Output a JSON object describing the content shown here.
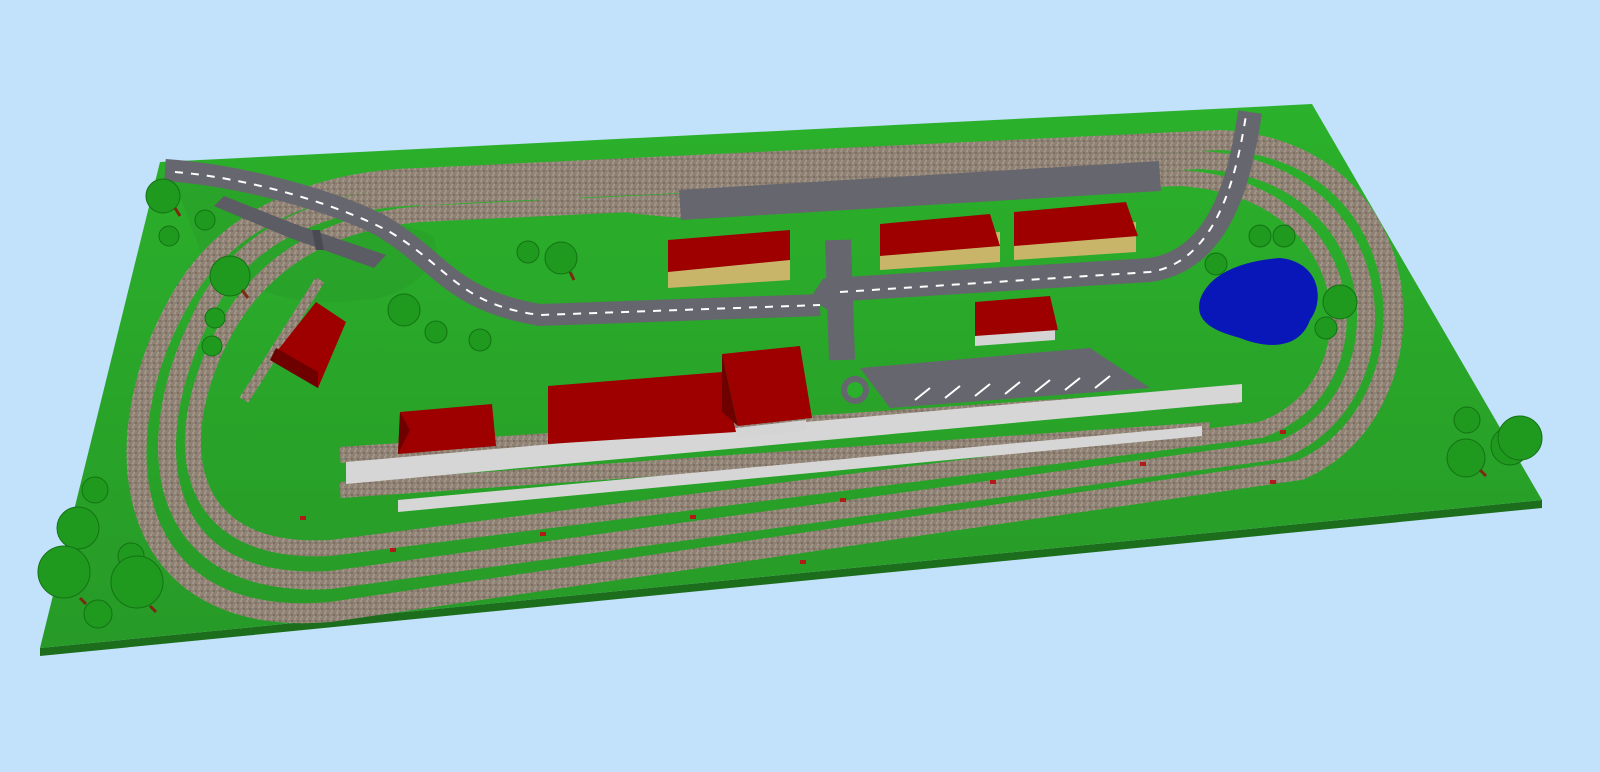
{
  "scene": {
    "sky_color": "#c2e1fb",
    "baseboard_color": "#2aa52a",
    "baseboard_edge_color": "#1c6e1c",
    "track_color": "#8a7b6c",
    "sleeper_color": "#6b4c3a",
    "rail_color": "#c9c3bb",
    "road_color": "#66666e",
    "road_marking_color": "#ffffff",
    "platform_color": "#d6d6d6",
    "roof_color": "#9e0000",
    "roof_dark_color": "#6e0000",
    "wall_color": "#c9b56a",
    "water_color": "#0a17b8",
    "tree_color": "#1f9a1f",
    "tree_dark_color": "#137313",
    "trunk_color": "#7a2a10"
  }
}
